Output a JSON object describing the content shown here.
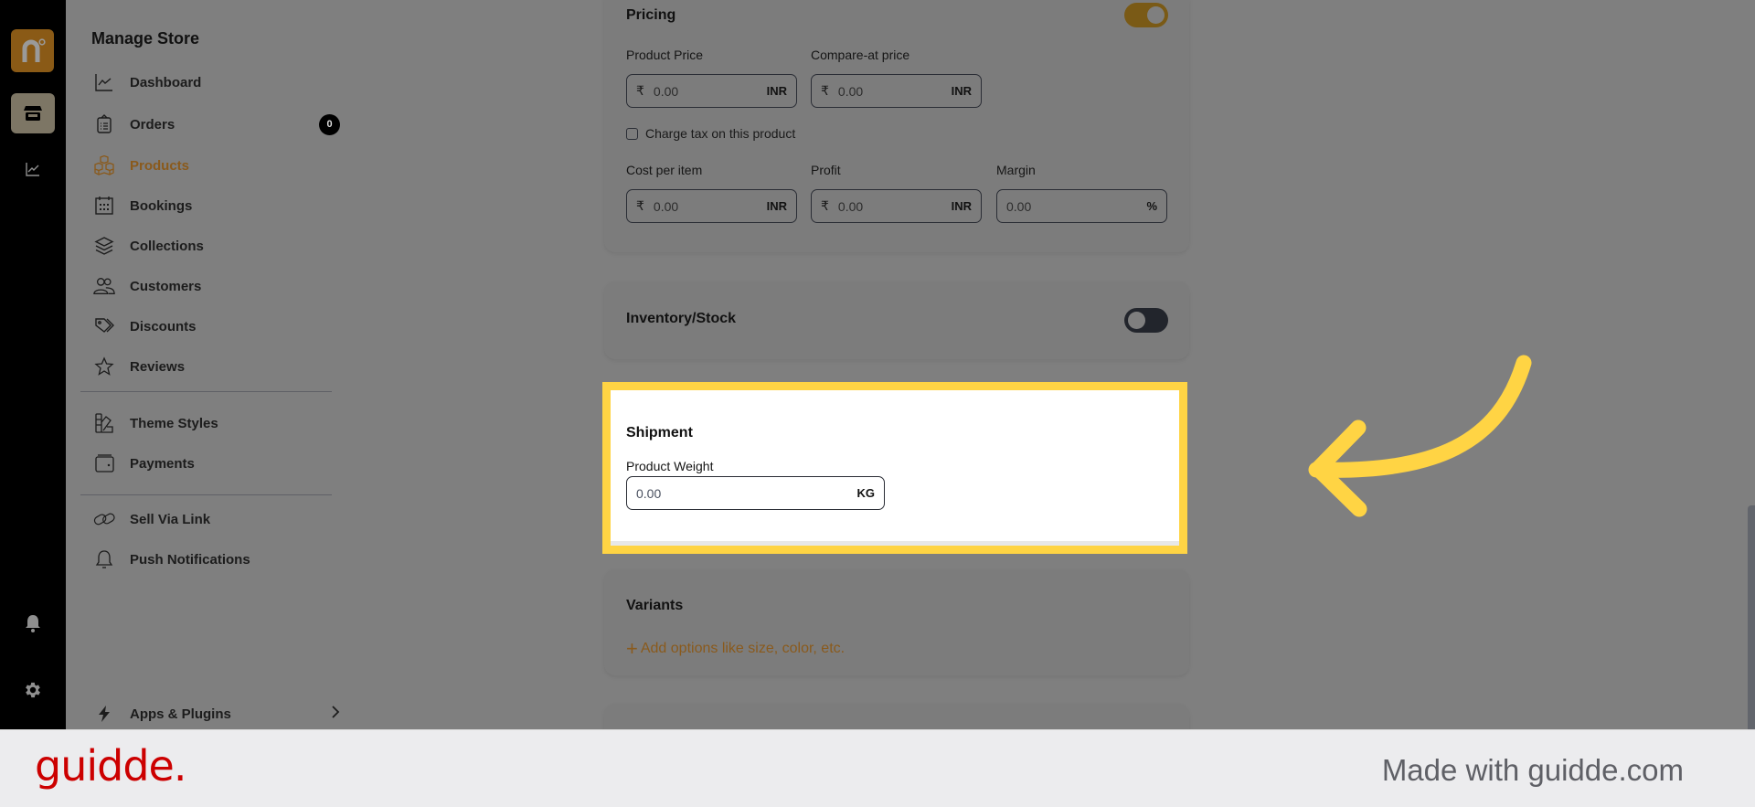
{
  "rail": {
    "logo_letter": "n",
    "icons": [
      "logo-icon",
      "store-icon",
      "analytics-icon",
      "bell-icon",
      "gear-icon"
    ]
  },
  "sidebar": {
    "title": "Manage Store",
    "groups": [
      [
        {
          "label": "Dashboard",
          "icon": "chart-line-icon"
        },
        {
          "label": "Orders",
          "icon": "clipboard-icon",
          "badge": "0"
        },
        {
          "label": "Products",
          "icon": "boxes-icon",
          "active": true
        },
        {
          "label": "Bookings",
          "icon": "calendar-icon"
        },
        {
          "label": "Collections",
          "icon": "layers-icon"
        },
        {
          "label": "Customers",
          "icon": "users-icon"
        },
        {
          "label": "Discounts",
          "icon": "tag-icon"
        },
        {
          "label": "Reviews",
          "icon": "star-icon"
        }
      ],
      [
        {
          "label": "Theme Styles",
          "icon": "swatch-icon"
        },
        {
          "label": "Payments",
          "icon": "wallet-icon"
        }
      ],
      [
        {
          "label": "Sell Via Link",
          "icon": "link-icon"
        },
        {
          "label": "Push Notifications",
          "icon": "bell-icon"
        }
      ]
    ],
    "apps": {
      "label": "Apps & Plugins",
      "icon": "bolt-icon"
    }
  },
  "pricing": {
    "title": "Pricing",
    "enabled": true,
    "product_price": {
      "label": "Product Price",
      "currency": "₹",
      "value": "0.00",
      "unit": "INR"
    },
    "compare_price": {
      "label": "Compare-at price",
      "currency": "₹",
      "value": "0.00",
      "unit": "INR"
    },
    "charge_tax": {
      "label": "Charge tax on this product",
      "checked": false
    },
    "cost_per_item": {
      "label": "Cost per item",
      "currency": "₹",
      "value": "0.00",
      "unit": "INR"
    },
    "profit": {
      "label": "Profit",
      "currency": "₹",
      "value": "0.00",
      "unit": "INR"
    },
    "margin": {
      "label": "Margin",
      "value": "0.00",
      "unit": "%"
    }
  },
  "inventory": {
    "title": "Inventory/Stock",
    "enabled": false
  },
  "shipment": {
    "title": "Shipment",
    "weight": {
      "label": "Product Weight",
      "value": "0.00",
      "unit": "KG"
    }
  },
  "variants": {
    "title": "Variants",
    "add_label": "Add options like size, color, etc.",
    "add_icon": "+"
  },
  "footer": {
    "brand": "guidde.",
    "tagline": "Made with guidde.com"
  },
  "colors": {
    "accent": "#8a5a1c",
    "highlight": "#ffd444",
    "toggle_on": "#7a5a16",
    "brand_red": "#cc0000"
  }
}
